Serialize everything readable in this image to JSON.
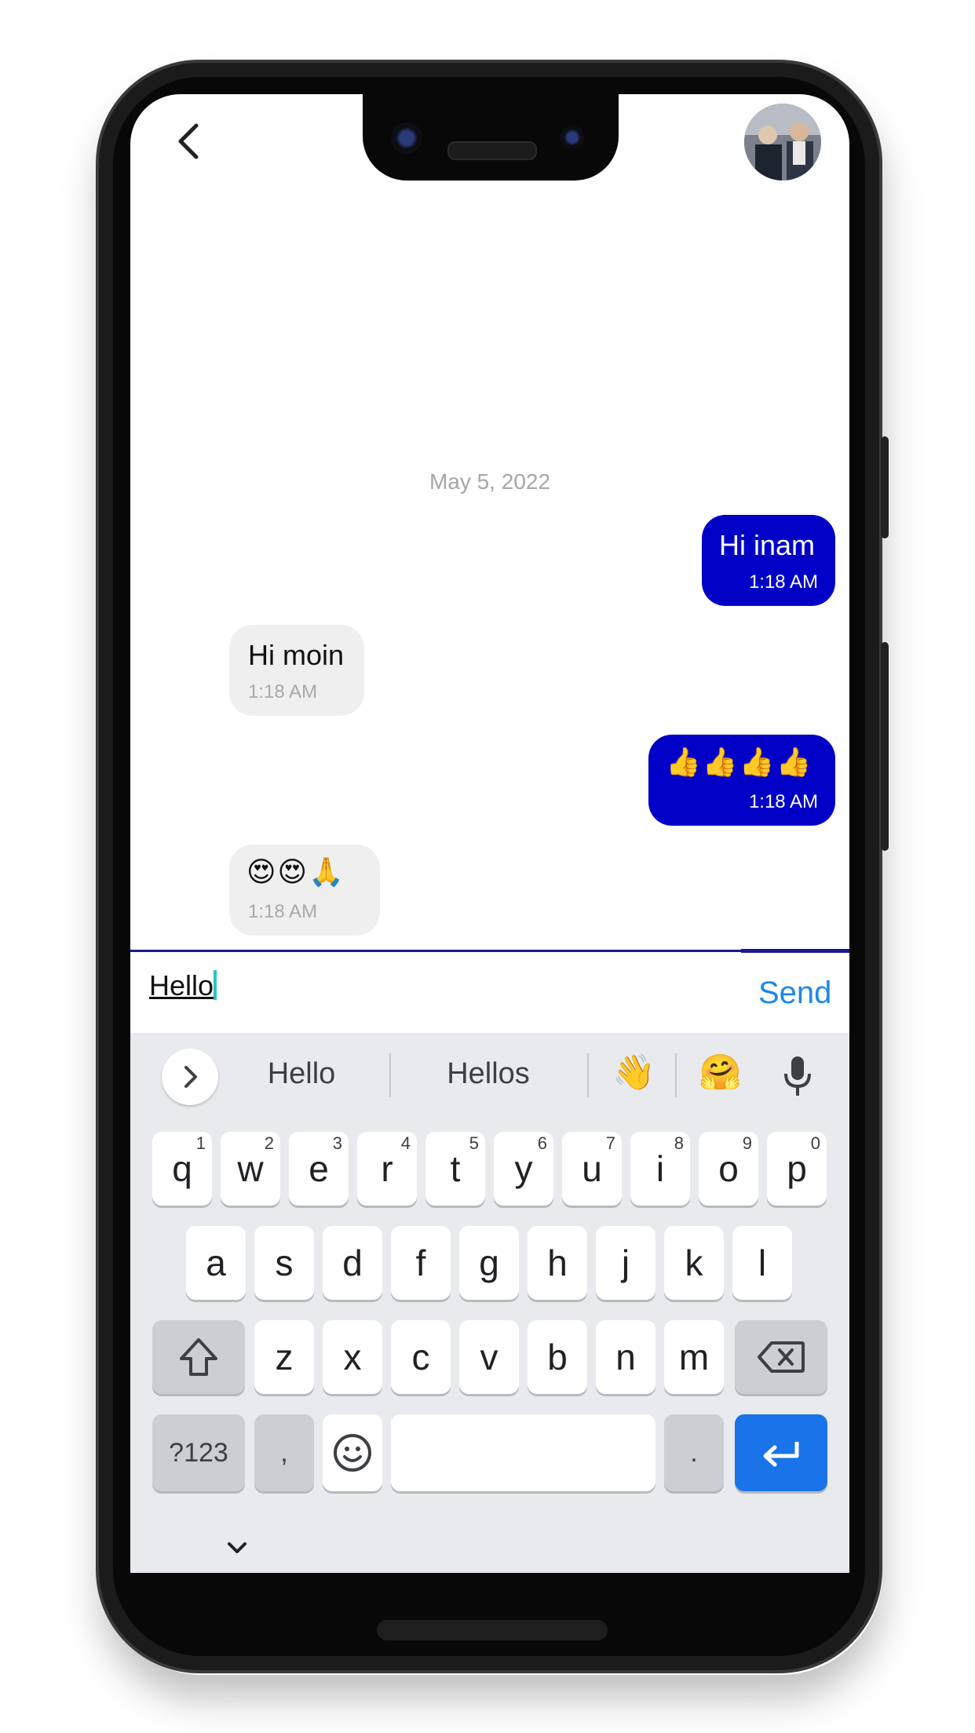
{
  "chat": {
    "date_label": "May 5, 2022",
    "messages": [
      {
        "direction": "out",
        "text": "Hi inam",
        "time": "1:18 AM"
      },
      {
        "direction": "in",
        "text": "Hi moin",
        "time": "1:18 AM"
      },
      {
        "direction": "out",
        "text": "👍👍👍👍",
        "time": "1:18 AM"
      },
      {
        "direction": "in",
        "text": "😍😍🙏",
        "time": "1:18 AM"
      }
    ]
  },
  "composer": {
    "value": "Hello",
    "send_label": "Send"
  },
  "keyboard": {
    "suggestions": [
      "Hello",
      "Hellos"
    ],
    "emoji_suggestions": [
      "👋",
      "🤗"
    ],
    "row1": [
      {
        "key": "q",
        "hint": "1"
      },
      {
        "key": "w",
        "hint": "2"
      },
      {
        "key": "e",
        "hint": "3"
      },
      {
        "key": "r",
        "hint": "4"
      },
      {
        "key": "t",
        "hint": "5"
      },
      {
        "key": "y",
        "hint": "6"
      },
      {
        "key": "u",
        "hint": "7"
      },
      {
        "key": "i",
        "hint": "8"
      },
      {
        "key": "o",
        "hint": "9"
      },
      {
        "key": "p",
        "hint": "0"
      }
    ],
    "row2": [
      "a",
      "s",
      "d",
      "f",
      "g",
      "h",
      "j",
      "k",
      "l"
    ],
    "row3": [
      "z",
      "x",
      "c",
      "v",
      "b",
      "n",
      "m"
    ],
    "symbols_label": "?123",
    "comma_label": ",",
    "period_label": "."
  },
  "colors": {
    "outgoing_bubble": "#0000c7",
    "incoming_bubble": "#efefef",
    "send_text": "#1e88e5",
    "enter_key": "#1a73e8"
  },
  "icons": [
    "back-chevron-icon",
    "avatar-photo",
    "chevron-right-icon",
    "microphone-icon",
    "shift-icon",
    "backspace-icon",
    "emoji-smiley-icon",
    "enter-arrow-icon",
    "keyboard-hide-chevron-icon"
  ]
}
